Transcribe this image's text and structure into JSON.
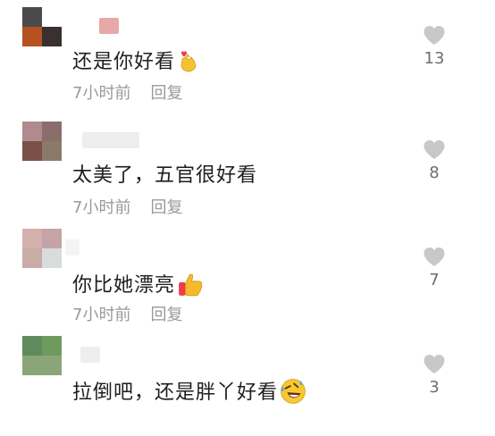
{
  "comments": [
    {
      "text": "还是你好看",
      "emoji": "heart-hand-emoji",
      "time": "7小时前",
      "reply": "回复",
      "likes": "13",
      "avatar_colors": [
        "#4a4a4a",
        "#ffffff",
        "#b5521f",
        "#3a3030"
      ],
      "name_blur_color": "#e8a8a8"
    },
    {
      "text": "太美了，五官很好看",
      "emoji": "",
      "time": "7小时前",
      "reply": "回复",
      "likes": "8",
      "avatar_colors": [
        "#b08a8e",
        "#8a6e6c",
        "#7a5048",
        "#8a7a6a"
      ],
      "name_blur_color": "#e0e0e0"
    },
    {
      "text": "你比她漂亮",
      "emoji": "thumbs-up-emoji",
      "time": "7小时前",
      "reply": "回复",
      "likes": "7",
      "avatar_colors": [
        "#d4b0ac",
        "#c4a4a6",
        "#c8aca6",
        "#d8dcdc"
      ],
      "name_blur_color": "#f2f2f2"
    },
    {
      "text": "拉倒吧，还是胖丫好看",
      "emoji": "rolling-laughing-emoji",
      "time": "",
      "reply": "",
      "likes": "3",
      "avatar_colors": [
        "#5e8a5c",
        "#6e9a5e",
        "#8aa678",
        "#8aa678"
      ],
      "name_blur_color": "#eeeeee"
    }
  ],
  "colors": {
    "text": "#1d1d1d",
    "meta": "#9a9a9a",
    "heart": "#c8c8c8",
    "like_count": "#6e6e6e"
  }
}
